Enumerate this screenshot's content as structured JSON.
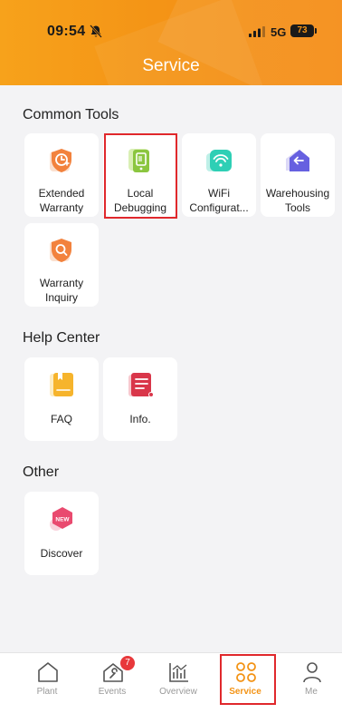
{
  "status": {
    "time": "09:54",
    "network": "5G",
    "battery": "73"
  },
  "header": {
    "title": "Service"
  },
  "sections": {
    "common": {
      "title": "Common Tools",
      "items": [
        {
          "line1": "Extended",
          "line2": "Warranty"
        },
        {
          "line1": "Local",
          "line2": "Debugging"
        },
        {
          "line1": "WiFi",
          "line2": "Configurat..."
        },
        {
          "line1": "Warehousing",
          "line2": "Tools"
        },
        {
          "line1": "Warranty",
          "line2": "Inquiry"
        }
      ]
    },
    "help": {
      "title": "Help Center",
      "items": [
        {
          "label": "FAQ"
        },
        {
          "label": "Info."
        }
      ]
    },
    "other": {
      "title": "Other",
      "items": [
        {
          "label": "Discover",
          "icon_text": "NEW"
        }
      ]
    }
  },
  "tabbar": {
    "tabs": [
      {
        "label": "Plant"
      },
      {
        "label": "Events",
        "badge": "7"
      },
      {
        "label": "Overview"
      },
      {
        "label": "Service",
        "active": true
      },
      {
        "label": "Me"
      }
    ]
  },
  "colors": {
    "accent": "#f39315",
    "highlight": "#e0282c",
    "badge": "#e8383b"
  }
}
